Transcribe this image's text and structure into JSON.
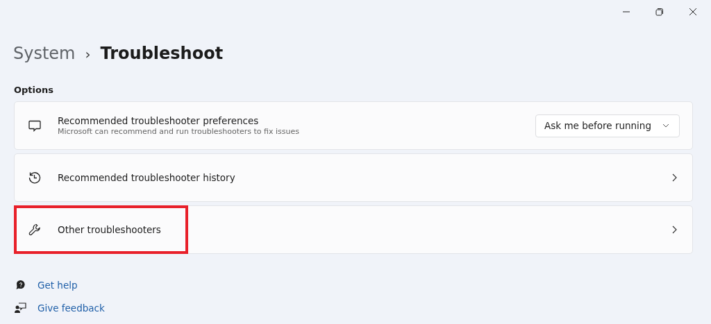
{
  "breadcrumb": {
    "parent": "System",
    "separator": "›",
    "current": "Troubleshoot"
  },
  "section_title": "Options",
  "items": [
    {
      "kind": "dropdown",
      "title": "Recommended troubleshooter preferences",
      "subtitle": "Microsoft can recommend and run troubleshooters to fix issues",
      "value": "Ask me before running",
      "highlighted": false
    },
    {
      "kind": "link",
      "title": "Recommended troubleshooter history",
      "highlighted": false
    },
    {
      "kind": "link",
      "title": "Other troubleshooters",
      "highlighted": true
    }
  ],
  "links": [
    {
      "label": "Get help"
    },
    {
      "label": "Give feedback"
    }
  ]
}
